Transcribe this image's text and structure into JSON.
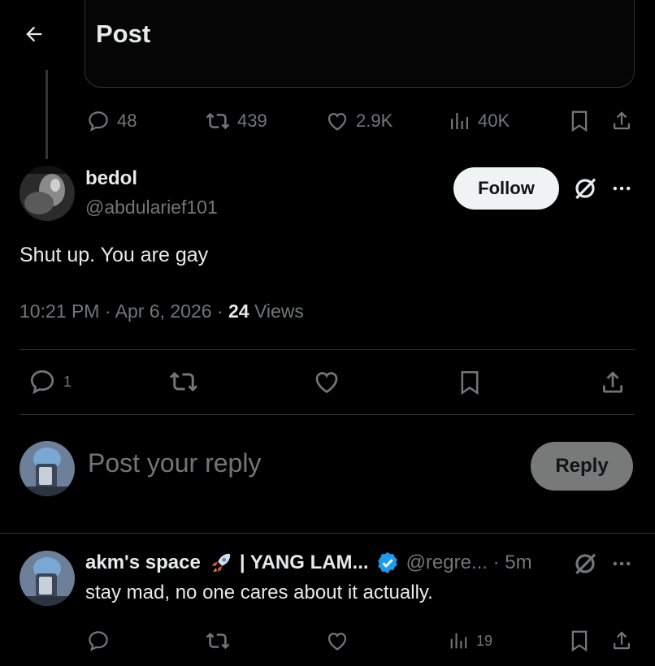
{
  "header": {
    "title": "Post"
  },
  "quoted_post_actions": {
    "replies": "48",
    "reposts": "439",
    "likes": "2.9K",
    "views": "40K"
  },
  "main_post": {
    "author_name": "bedol",
    "author_handle": "@abdularief101",
    "follow_label": "Follow",
    "text": "Shut up. You are gay",
    "time": "10:21 PM",
    "date": "Apr 6, 2026",
    "views_count": "24",
    "views_label": "Views",
    "reply_count": "1"
  },
  "composer": {
    "placeholder": "Post your reply",
    "reply_label": "Reply"
  },
  "reply": {
    "author_name": "akm's space",
    "author_suffix": "| YANG LAM...",
    "handle": "@regre...",
    "time": "5m",
    "text": "stay mad, no one cares about it actually.",
    "views": "19"
  },
  "icons": {
    "back": "arrow-left-icon",
    "reply": "speech-bubble-icon",
    "repost": "repost-icon",
    "like": "heart-icon",
    "views": "bar-chart-icon",
    "bookmark": "bookmark-icon",
    "share": "share-icon",
    "grok": "grok-icon",
    "more": "more-icon",
    "verified": "verified-badge-icon",
    "rocket": "rocket-icon"
  },
  "colors": {
    "background": "#000000",
    "text": "#e7e9ea",
    "muted": "#71767b",
    "divider": "#2f3336",
    "verified": "#1d9bf0",
    "follow_bg": "#eff3f4"
  }
}
